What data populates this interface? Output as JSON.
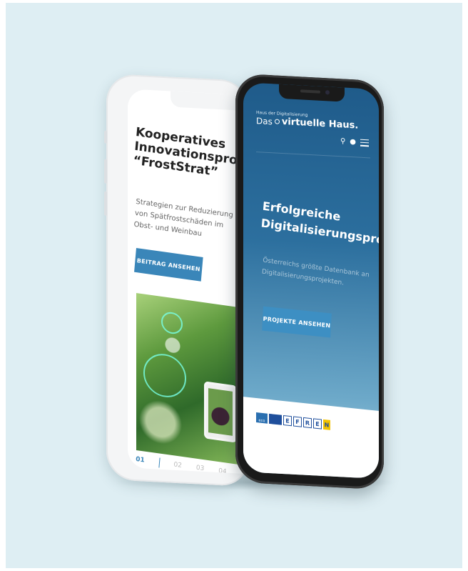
{
  "back_phone": {
    "title": "Kooperatives Innovationsprojekt “FrostStrat”",
    "subtitle": "Strategien zur Reduzierung von Spätfrostschäden im Obst- und Weinbau",
    "button_label": "BEITRAG ANSEHEN",
    "pager": [
      "01",
      "02",
      "03",
      "04"
    ],
    "active_page": "01"
  },
  "front_phone": {
    "logo_small": "Haus der Digitalisierung",
    "logo_prefix": "Das",
    "logo_brand": "virtuelle Haus.",
    "headline": "Erfolgreiche Digitalisierungsprojekte",
    "subtitle": "Österreichs größte Datenbank an Digitalisierungsprojekten.",
    "button_label": "PROJEKTE ANSEHEN",
    "icons": [
      "search-icon",
      "user-icon",
      "menu-icon"
    ],
    "footer_logos": {
      "eco_label": "eco",
      "letters": [
        "E",
        "F",
        "R",
        "E"
      ],
      "n_label": "N"
    }
  },
  "colors": {
    "background": "#deeef3",
    "accent": "#3a86b9",
    "front_screen_top": "#1f5b8a",
    "front_screen_bottom": "#a6cfe0"
  }
}
